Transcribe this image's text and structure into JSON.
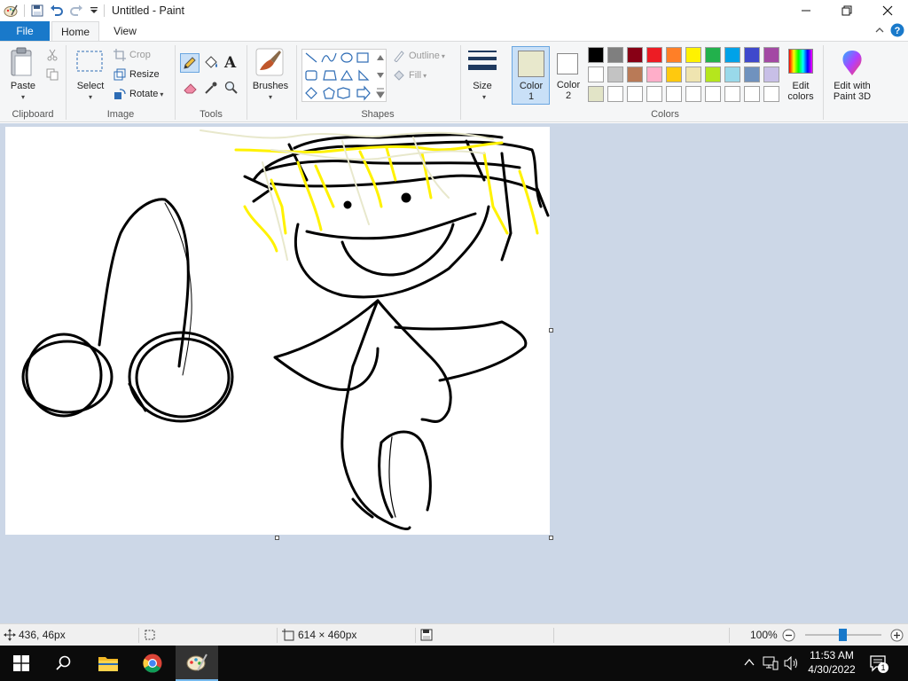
{
  "window": {
    "title": "Untitled - Paint"
  },
  "tabs": {
    "file": "File",
    "home": "Home",
    "view": "View"
  },
  "ribbon": {
    "clipboard": {
      "group": "Clipboard",
      "paste": "Paste"
    },
    "image": {
      "group": "Image",
      "select": "Select",
      "crop": "Crop",
      "resize": "Resize",
      "rotate": "Rotate"
    },
    "tools": {
      "group": "Tools"
    },
    "brushes": {
      "label": "Brushes"
    },
    "shapes": {
      "group": "Shapes",
      "outline": "Outline",
      "fill": "Fill"
    },
    "size": {
      "label": "Size"
    },
    "colors": {
      "group": "Colors",
      "color1": "Color 1",
      "color1_line1": "Color",
      "color1_line2": "1",
      "color2_line1": "Color",
      "color2_line2": "2",
      "edit_line1": "Edit",
      "edit_line2": "colors",
      "paint3d_line1": "Edit with",
      "paint3d_line2": "Paint 3D",
      "color1_value": "#e8e8cc",
      "color2_value": "#ffffff",
      "palette_row1": [
        "#000000",
        "#7f7f7f",
        "#880015",
        "#ed1c24",
        "#ff7f27",
        "#fff200",
        "#22b14c",
        "#00a2e8",
        "#3f48cc",
        "#a349a4"
      ],
      "palette_row2": [
        "#ffffff",
        "#c3c3c3",
        "#b97a57",
        "#ffaec9",
        "#ffc90e",
        "#efe4b0",
        "#b5e61d",
        "#99d9ea",
        "#7092be",
        "#c8bfe7"
      ],
      "palette_row3": [
        "#e2e4c7",
        "#ffffff",
        "#ffffff",
        "#ffffff",
        "#ffffff",
        "#ffffff",
        "#ffffff",
        "#ffffff",
        "#ffffff",
        "#ffffff"
      ]
    }
  },
  "status": {
    "cursor_pos": "436, 46px",
    "canvas_size": "614 × 460px",
    "zoom": "100%"
  },
  "taskbar": {
    "time": "11:53 AM",
    "date": "4/30/2022",
    "notifications": "1"
  }
}
